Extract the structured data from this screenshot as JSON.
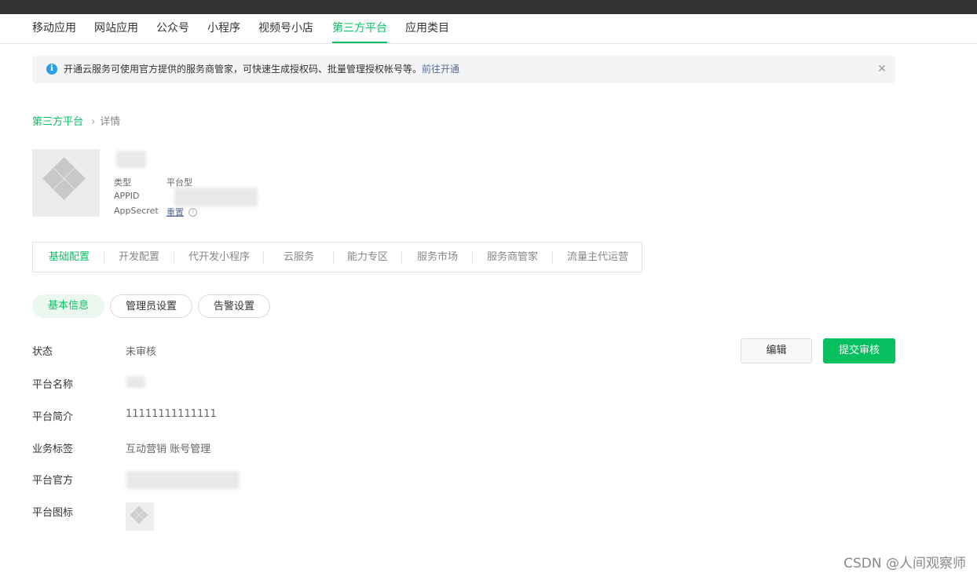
{
  "nav": {
    "items": [
      {
        "label": "移动应用"
      },
      {
        "label": "网站应用"
      },
      {
        "label": "公众号"
      },
      {
        "label": "小程序"
      },
      {
        "label": "视频号小店"
      },
      {
        "label": "第三方平台",
        "active": true
      },
      {
        "label": "应用类目"
      }
    ]
  },
  "notice": {
    "icon": "info-icon",
    "text": "开通云服务可使用官方提供的服务商管家，可快速生成授权码、批量管理授权帐号等。",
    "link": "前往开通"
  },
  "breadcrumb": {
    "parent": "第三方平台",
    "current": "详情"
  },
  "app_meta": {
    "type_label": "类型",
    "type_value": "平台型",
    "appid_label": "APPID",
    "secret_label": "AppSecret",
    "secret_action": "重置"
  },
  "tabs": [
    {
      "label": "基础配置",
      "active": true
    },
    {
      "label": "开发配置"
    },
    {
      "label": "代开发小程序"
    },
    {
      "label": "云服务"
    },
    {
      "label": "能力专区"
    },
    {
      "label": "服务市场"
    },
    {
      "label": "服务商管家"
    },
    {
      "label": "流量主代运营"
    }
  ],
  "subtabs": [
    {
      "label": "基本信息",
      "active": true
    },
    {
      "label": "管理员设置"
    },
    {
      "label": "告警设置"
    }
  ],
  "info_rows": {
    "status": {
      "label": "状态",
      "value": "未审核"
    },
    "name": {
      "label": "平台名称"
    },
    "intro": {
      "label": "平台简介",
      "value": "11111111111111"
    },
    "tags": {
      "label": "业务标签",
      "value": "互动营销 账号管理"
    },
    "site": {
      "label": "平台官方"
    },
    "icon": {
      "label": "平台图标"
    }
  },
  "actions": {
    "edit": "编辑",
    "submit": "提交审核"
  },
  "watermark": "CSDN @人间观察师",
  "colors": {
    "accent": "#07c160",
    "link": "#576b95",
    "topbar": "#333333",
    "info": "#2aa0e8"
  }
}
